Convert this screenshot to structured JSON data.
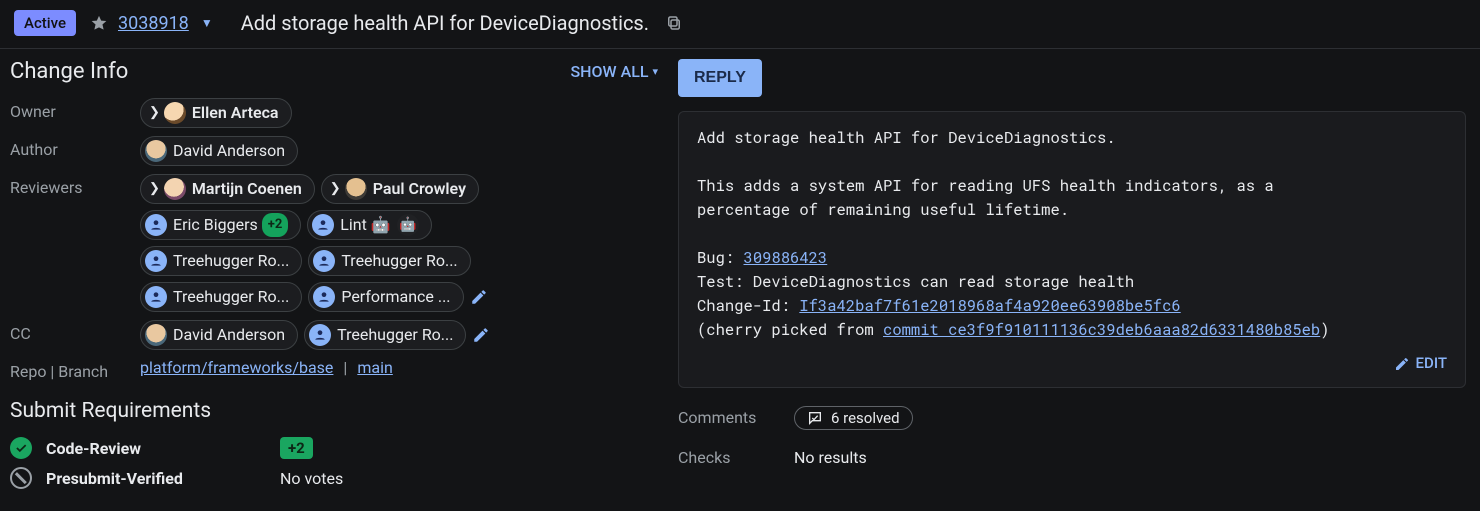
{
  "header": {
    "status": "Active",
    "change_number": "3038918",
    "title": "Add storage health API for DeviceDiagnostics."
  },
  "left": {
    "heading": "Change Info",
    "show_all": "SHOW ALL",
    "owner_label": "Owner",
    "author_label": "Author",
    "reviewers_label": "Reviewers",
    "cc_label": "CC",
    "repo_label": "Repo | Branch",
    "owner": "Ellen Arteca",
    "author": "David Anderson",
    "reviewers": {
      "r1": "Martijn Coenen",
      "r2": "Paul Crowley",
      "r3": "Eric Biggers",
      "r3_vote": "+2",
      "r4": "Lint 🤖",
      "r5": "Treehugger Ro...",
      "r6": "Treehugger Ro...",
      "r7": "Treehugger Ro...",
      "r8": "Performance ..."
    },
    "cc": {
      "c1": "David Anderson",
      "c2": "Treehugger Ro..."
    },
    "repo": "platform/frameworks/base",
    "branch": "main"
  },
  "subreq": {
    "heading": "Submit Requirements",
    "code_review": "Code-Review",
    "code_review_vote": "+2",
    "presubmit": "Presubmit-Verified",
    "no_votes": "No votes"
  },
  "right": {
    "reply": "REPLY",
    "commit": {
      "subject": "Add storage health API for DeviceDiagnostics.",
      "body1": "This adds a system API for reading UFS health indicators, as a",
      "body2": "percentage of remaining useful lifetime.",
      "bug_label": "Bug: ",
      "bug_link": "309886423",
      "test_line": "Test: DeviceDiagnostics can read storage health",
      "changeid_label": "Change-Id: ",
      "changeid_link": "If3a42baf7f61e2018968af4a920ee63908be5fc6",
      "cherry_prefix": "(cherry picked from ",
      "cherry_link": "commit ce3f9f910111136c39deb6aaa82d6331480b85eb",
      "cherry_suffix": ")",
      "edit": "EDIT"
    },
    "comments_label": "Comments",
    "comments_resolved": "6 resolved",
    "checks_label": "Checks",
    "checks_value": "No results"
  }
}
